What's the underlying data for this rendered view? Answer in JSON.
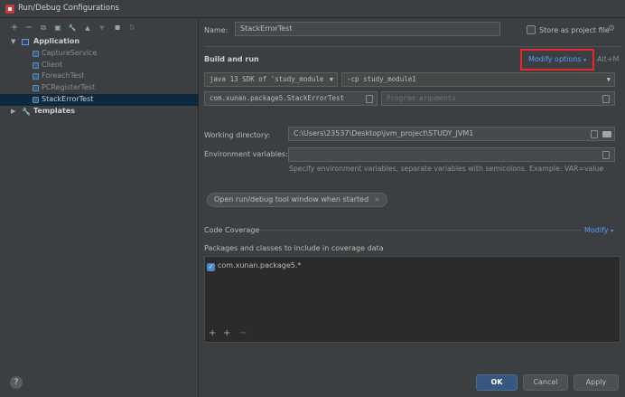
{
  "window": {
    "title": "Run/Debug Configurations"
  },
  "toolbar": {
    "add": "+",
    "remove": "−",
    "copy": "⧉",
    "save": "▣",
    "edit": "🔧",
    "up": "▲",
    "down": "▼",
    "folder": "▪",
    "sort": "⇅"
  },
  "tree": {
    "application_label": "Application",
    "items": [
      "CaptureService",
      "Client",
      "ForeachTest",
      "PCRegisterTest",
      "StackErrorTest"
    ],
    "templates_label": "Templates"
  },
  "form": {
    "name_label": "Name:",
    "name_value": "StackErrorTest",
    "store_label": "Store as project file",
    "section_build_run": "Build and run",
    "modify_options": "Modify options",
    "modify_shortcut": "Alt+M",
    "jre_value": "java 13  SDK of 'study_module",
    "classpath_value": "-cp  study_module1",
    "main_class_value": "com.xunan.package5.StackErrorTest",
    "program_args_placeholder": "Program arguments",
    "working_dir_label": "Working directory:",
    "working_dir_value": "C:\\Users\\23537\\Desktop\\jvm_project\\STUDY_JVM1",
    "env_label": "Environment variables:",
    "env_hint": "Specify environment variables, separate variables with semicolons. Example: VAR=value",
    "chip_label": "Open run/debug tool window when started",
    "chip_close": "×",
    "coverage_label": "Code Coverage",
    "coverage_modify": "Modify",
    "packages_label": "Packages and classes to include in coverage data",
    "package_item": "com.xunan.package5.*"
  },
  "footer": {
    "help": "?",
    "ok": "OK",
    "cancel": "Cancel",
    "apply": "Apply"
  },
  "colors": {
    "accent": "#589df6",
    "highlight": "#e8262b",
    "selection": "#0d293e"
  }
}
